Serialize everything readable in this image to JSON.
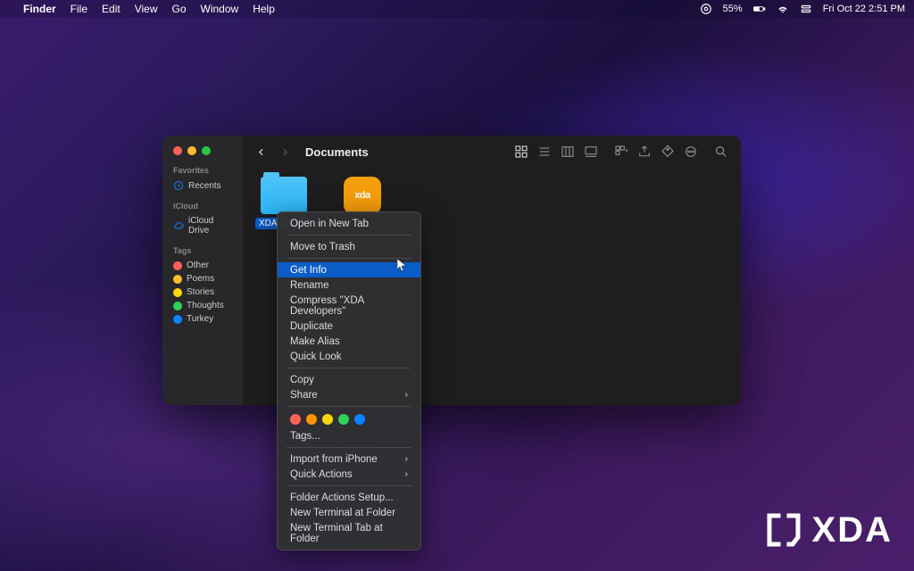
{
  "menubar": {
    "app_name": "Finder",
    "menus": [
      "File",
      "Edit",
      "View",
      "Go",
      "Window",
      "Help"
    ],
    "battery_pct": "55%",
    "date_time": "Fri Oct 22  2:51 PM"
  },
  "finder": {
    "title": "Documents",
    "sidebar": {
      "favorites_header": "Favorites",
      "favorites": [
        {
          "label": "Recents"
        }
      ],
      "icloud_header": "iCloud",
      "icloud": [
        {
          "label": "iCloud Drive"
        }
      ],
      "tags_header": "Tags",
      "tags": [
        {
          "label": "Other",
          "color": "#ff6159"
        },
        {
          "label": "Poems",
          "color": "#ffbd2e"
        },
        {
          "label": "Stories",
          "color": "#ffd60a"
        },
        {
          "label": "Thoughts",
          "color": "#30d158"
        },
        {
          "label": "Turkey",
          "color": "#0a84ff"
        }
      ]
    },
    "files": [
      {
        "name": "XDA Developers",
        "selected": true,
        "type": "folder"
      },
      {
        "name": "xda",
        "selected": false,
        "type": "app"
      }
    ]
  },
  "context_menu": {
    "items": [
      {
        "label": "Open in New Tab"
      },
      {
        "sep": true
      },
      {
        "label": "Move to Trash"
      },
      {
        "sep": true
      },
      {
        "label": "Get Info",
        "highlighted": true
      },
      {
        "label": "Rename"
      },
      {
        "label": "Compress \"XDA Developers\""
      },
      {
        "label": "Duplicate"
      },
      {
        "label": "Make Alias"
      },
      {
        "label": "Quick Look"
      },
      {
        "sep": true
      },
      {
        "label": "Copy"
      },
      {
        "label": "Share",
        "submenu": true
      },
      {
        "sep": true
      },
      {
        "tags_row": true
      },
      {
        "label": "Tags..."
      },
      {
        "sep": true
      },
      {
        "label": "Import from iPhone",
        "submenu": true
      },
      {
        "label": "Quick Actions",
        "submenu": true
      },
      {
        "sep": true
      },
      {
        "label": "Folder Actions Setup..."
      },
      {
        "label": "New Terminal at Folder"
      },
      {
        "label": "New Terminal Tab at Folder"
      }
    ],
    "tag_colors": [
      "#ff6159",
      "#ff9500",
      "#ffd60a",
      "#30d158",
      "#0a84ff"
    ]
  },
  "watermark": "XDA"
}
